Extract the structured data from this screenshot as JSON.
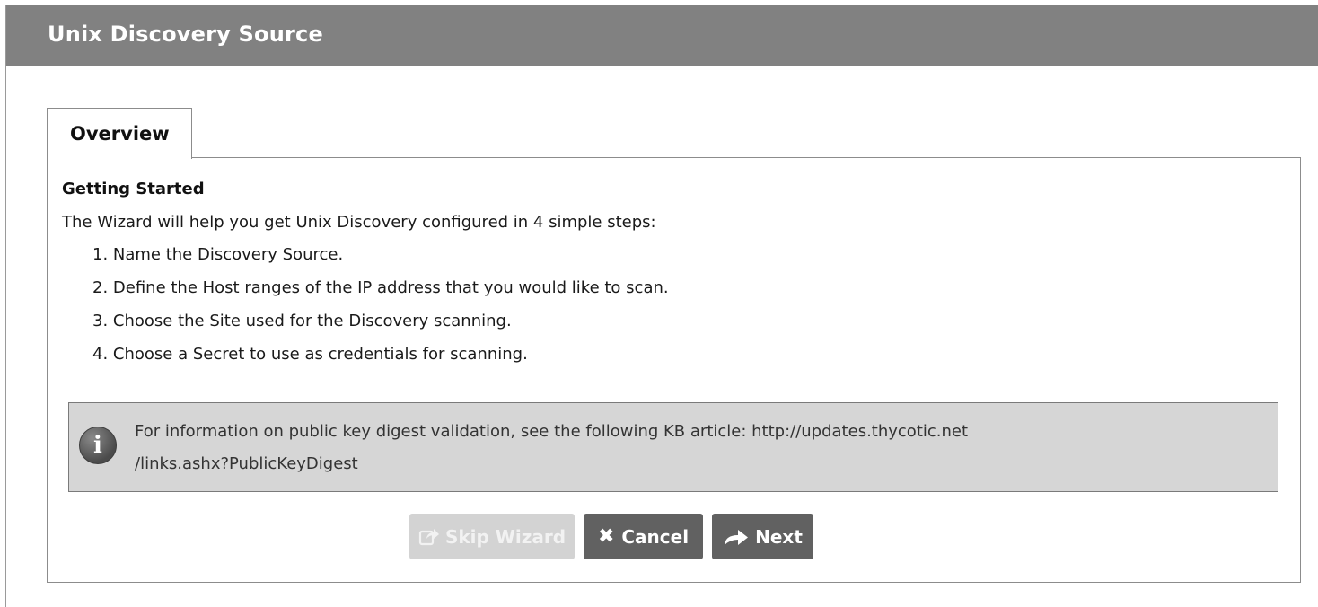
{
  "window": {
    "title": "Unix Discovery Source"
  },
  "tabs": [
    {
      "label": "Overview",
      "active": true
    }
  ],
  "overview": {
    "heading": "Getting Started",
    "intro": "The Wizard will help you get Unix Discovery configured in 4 simple steps:",
    "steps": [
      "1. Name the Discovery Source.",
      "2. Define the Host ranges of the IP address that you would like to scan.",
      "3. Choose the Site used for the Discovery scanning.",
      "4. Choose a Secret to use as credentials for scanning."
    ]
  },
  "info": {
    "icon": "info-icon",
    "line1": "For information on public key digest validation, see the following KB article: http://updates.thycotic.net",
    "line2": "/links.ashx?PublicKeyDigest"
  },
  "buttons": {
    "skip": {
      "label": "Skip Wizard",
      "icon": "skip-icon",
      "disabled": true
    },
    "cancel": {
      "label": "Cancel",
      "icon": "close-icon"
    },
    "next": {
      "label": "Next",
      "icon": "arrow-forward-icon"
    }
  },
  "colors": {
    "titlebar": "#818181",
    "info_background": "#d6d6d6",
    "button": "#616161",
    "button_disabled": "#d3d3d3"
  }
}
